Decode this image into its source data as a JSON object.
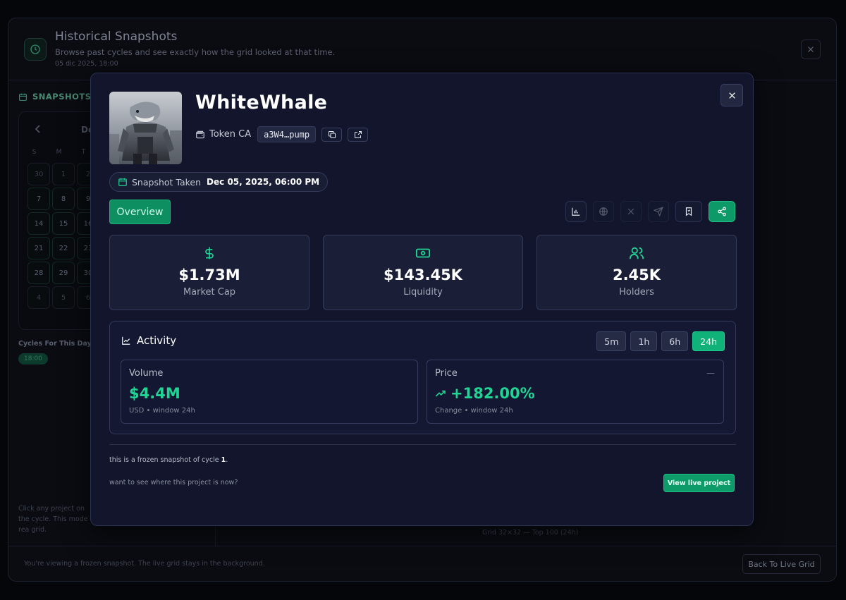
{
  "background": {
    "title": "Historical Snapshots",
    "subtitle": "Browse past cycles and see exactly how the grid looked at that time.",
    "date": "05 dic 2025, 18:00",
    "sidebar": {
      "snapshots_label": "SNAPSHOTS",
      "calendar_month": "De",
      "weekdays": [
        "S",
        "M",
        "T"
      ],
      "days": [
        "30",
        "1",
        "2",
        "7",
        "8",
        "9",
        "14",
        "15",
        "16",
        "21",
        "22",
        "23",
        "28",
        "29",
        "30",
        "4",
        "5",
        "6"
      ],
      "cycles_label": "Cycles For This Day",
      "cycle_time": "18:00",
      "help_text": "Click any project on the cycle. This mode is rea grid."
    },
    "grid_caption": "Grid 32×32 — Top 100 (24h)",
    "footer_text": "You're viewing a frozen snapshot. The live grid stays in the background.",
    "back_button": "Back To Live Grid"
  },
  "modal": {
    "token_name": "WhiteWhale",
    "ca_label": "Token CA",
    "ca_value": "a3W4…pump",
    "snapshot_label": "Snapshot Taken",
    "snapshot_value": "Dec 05, 2025, 06:00 PM",
    "tab_overview": "Overview",
    "stats": [
      {
        "icon": "dollar-icon",
        "value": "$1.73M",
        "label": "Market Cap"
      },
      {
        "icon": "banknote-icon",
        "value": "$143.45K",
        "label": "Liquidity"
      },
      {
        "icon": "users-icon",
        "value": "2.45K",
        "label": "Holders"
      }
    ],
    "activity": {
      "title": "Activity",
      "ranges": [
        "5m",
        "1h",
        "6h",
        "24h"
      ],
      "active_range": "24h",
      "volume": {
        "label": "Volume",
        "value": "$4.4M",
        "sub": "USD • window 24h"
      },
      "price": {
        "label": "Price",
        "value": "+182.00%",
        "sub": "Change • window 24h",
        "dash": "—"
      }
    },
    "frozen_prefix": "this is a frozen snapshot of cycle ",
    "frozen_cycle": "1",
    "frozen_suffix": ".",
    "want_text": "want to see where this project is now?",
    "live_button": "View live project"
  },
  "colors": {
    "accent": "#10b27a",
    "positive": "#1fd494",
    "modal_bg": "#12152b"
  }
}
